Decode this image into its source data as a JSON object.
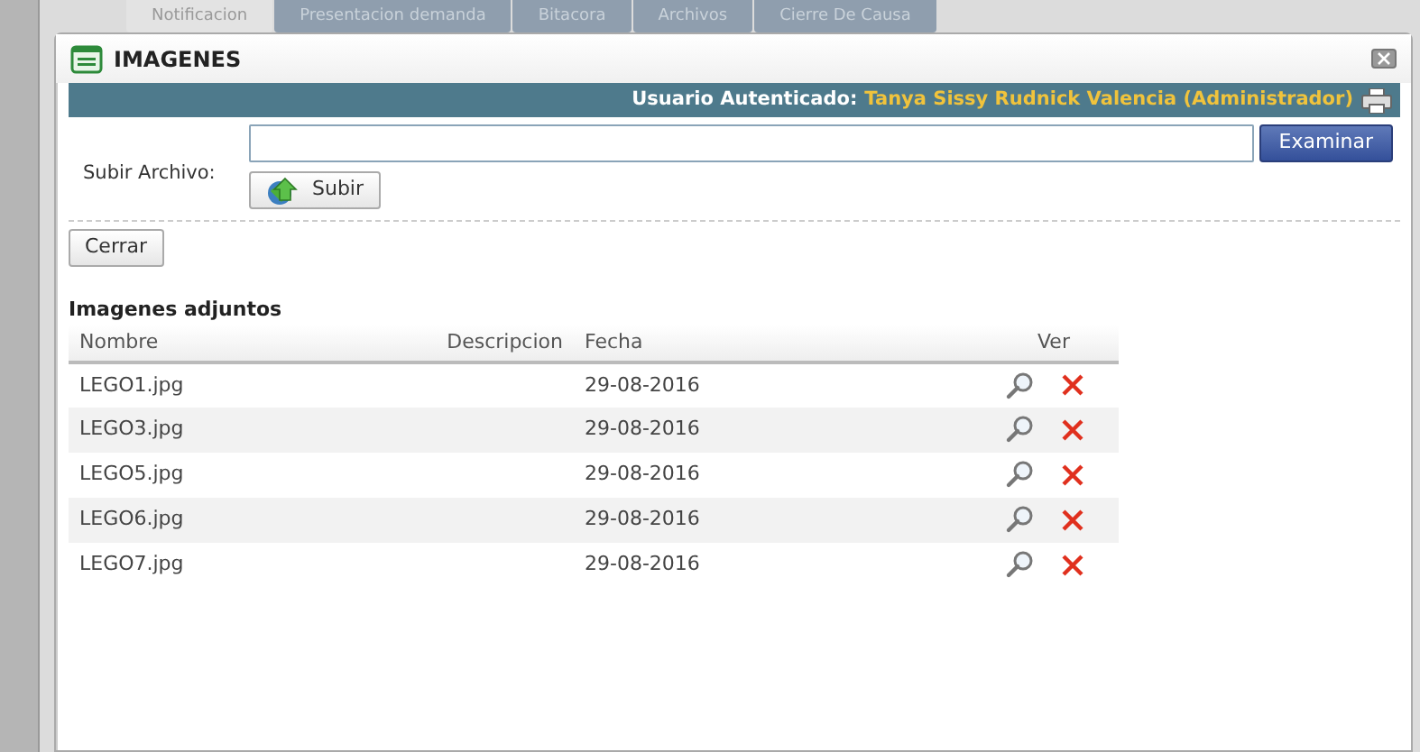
{
  "background_tabs": [
    {
      "label": "Notificacion",
      "selected": true
    },
    {
      "label": "Presentacion demanda",
      "selected": false
    },
    {
      "label": "Bitacora",
      "selected": false
    },
    {
      "label": "Archivos",
      "selected": false
    },
    {
      "label": "Cierre De Causa",
      "selected": false
    }
  ],
  "dialog": {
    "title": "IMAGENES"
  },
  "user_bar": {
    "label": "Usuario Autenticado:",
    "user": "Tanya Sissy Rudnick Valencia (Administrador)"
  },
  "upload": {
    "label": "Subir Archivo:",
    "browse_button": "Examinar",
    "upload_button": "Subir"
  },
  "close_button": "Cerrar",
  "table": {
    "title": "Imagenes adjuntos",
    "columns": [
      "Nombre",
      "Descripcion",
      "Fecha",
      "Ver"
    ],
    "rows": [
      {
        "name": "LEGO1.jpg",
        "date": "29-08-2016"
      },
      {
        "name": "LEGO3.jpg",
        "date": "29-08-2016"
      },
      {
        "name": "LEGO5.jpg",
        "date": "29-08-2016"
      },
      {
        "name": "LEGO6.jpg",
        "date": "29-08-2016"
      },
      {
        "name": "LEGO7.jpg",
        "date": "29-08-2016"
      }
    ]
  }
}
